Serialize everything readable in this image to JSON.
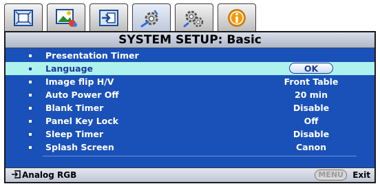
{
  "tabs": [
    {
      "name": "picture-icon",
      "active": false
    },
    {
      "name": "image-settings-icon",
      "active": false
    },
    {
      "name": "display-input-icon",
      "active": false
    },
    {
      "name": "system-setup-basic-icon",
      "active": true
    },
    {
      "name": "system-setup-advanced-icon",
      "active": false
    },
    {
      "name": "information-icon",
      "active": false
    }
  ],
  "header": {
    "title": "SYSTEM SETUP: Basic"
  },
  "menu": {
    "items": [
      {
        "label": "Presentation Timer",
        "value": ""
      },
      {
        "label": "Language",
        "value": "OK"
      },
      {
        "label": "Image flip H/V",
        "value": "Front Table"
      },
      {
        "label": "Auto Power Off",
        "value": "20 min"
      },
      {
        "label": "Blank Timer",
        "value": "Disable"
      },
      {
        "label": "Panel Key Lock",
        "value": "Off"
      },
      {
        "label": "Sleep Timer",
        "value": "Disable"
      },
      {
        "label": "Splash Screen",
        "value": "Canon"
      }
    ],
    "selected_index": 1
  },
  "footer": {
    "source_icon": "input-source-icon",
    "source_label": "Analog RGB",
    "menu_button": "MENU",
    "exit_label": "Exit"
  },
  "colors": {
    "panel_blue": "#1a51b8",
    "selection": "#aef2ee"
  }
}
